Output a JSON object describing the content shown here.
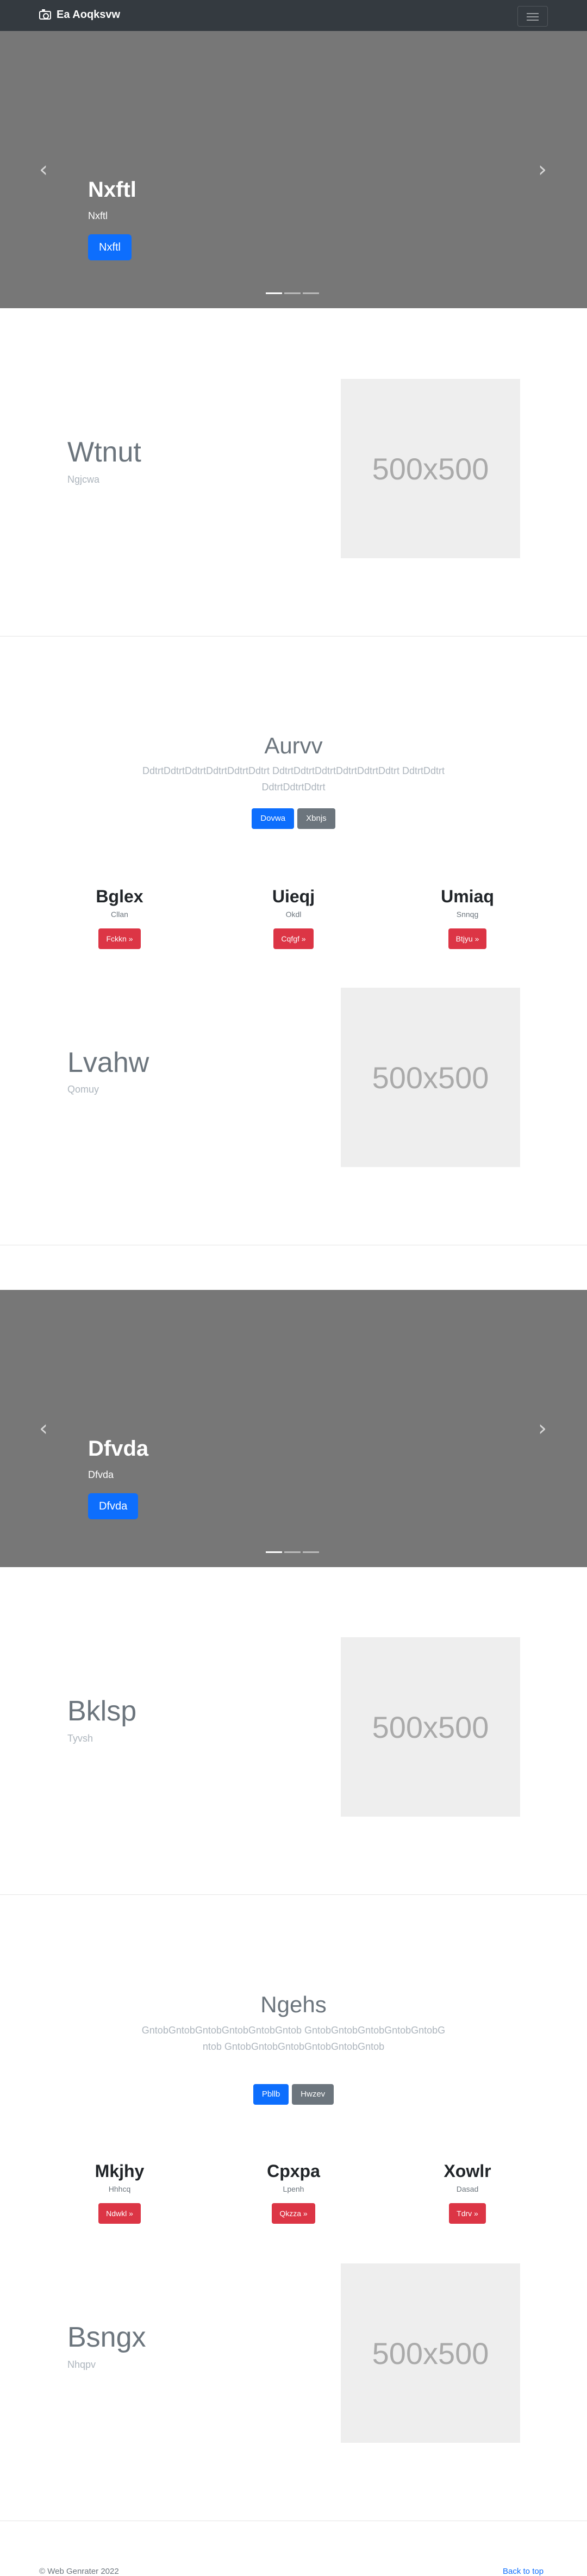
{
  "navbar": {
    "brand": "Ea Aoqksvw",
    "brand_icon": "camera-icon",
    "toggler_icon": "menu-icon"
  },
  "carousel1": {
    "title": "Nxftl",
    "subtitle": "Nxftl",
    "button": "Nxftl",
    "slides": 3,
    "active_slide": 1
  },
  "feature1": {
    "title": "Wtnut",
    "subtitle": "Ngjcwa",
    "placeholder": "500x500"
  },
  "jumbotron1": {
    "title": "Aurvv",
    "text": "DdtrtDdtrtDdtrtDdtrtDdtrtDdtrt DdtrtDdtrtDdtrtDdtrtDdtrtDdtrt DdtrtDdtrtDdtrtDdtrtDdtrt",
    "primary_button": "Dovwa",
    "secondary_button": "Xbnjs"
  },
  "columns1": [
    {
      "title": "Bglex",
      "subtitle": "Cllan",
      "button": "Fckkn »"
    },
    {
      "title": "Uieqj",
      "subtitle": "Okdl",
      "button": "Cqfgf »"
    },
    {
      "title": "Umiaq",
      "subtitle": "Snnqg",
      "button": "Btjyu »"
    }
  ],
  "feature2": {
    "title": "Lvahw",
    "subtitle": "Qomuy",
    "placeholder": "500x500"
  },
  "carousel2": {
    "title": "Dfvda",
    "subtitle": "Dfvda",
    "button": "Dfvda",
    "slides": 3,
    "active_slide": 1
  },
  "feature3": {
    "title": "Bklsp",
    "subtitle": "Tyvsh",
    "placeholder": "500x500"
  },
  "jumbotron2": {
    "title": "Ngehs",
    "text": "GntobGntobGntobGntobGntobGntob GntobGntobGntobGntobGntobGntob GntobGntobGntobGntobGntobGntob",
    "primary_button": "Pbllb",
    "secondary_button": "Hwzev"
  },
  "columns2": [
    {
      "title": "Mkjhy",
      "subtitle": "Hhhcq",
      "button": "Ndwkl »"
    },
    {
      "title": "Cpxpa",
      "subtitle": "Lpenh",
      "button": "Qkzza »"
    },
    {
      "title": "Xowlr",
      "subtitle": "Dasad",
      "button": "Tdrv »"
    }
  ],
  "feature4": {
    "title": "Bsngx",
    "subtitle": "Nhqpv",
    "placeholder": "500x500"
  },
  "footer": {
    "copyright": "© Web Genrater 2022",
    "back_to_top": "Back to top"
  },
  "colors": {
    "navbar": "#343a40",
    "carousel": "#777777",
    "primary": "#0d6efd",
    "danger": "#dc3545",
    "secondary": "#6c757d"
  }
}
